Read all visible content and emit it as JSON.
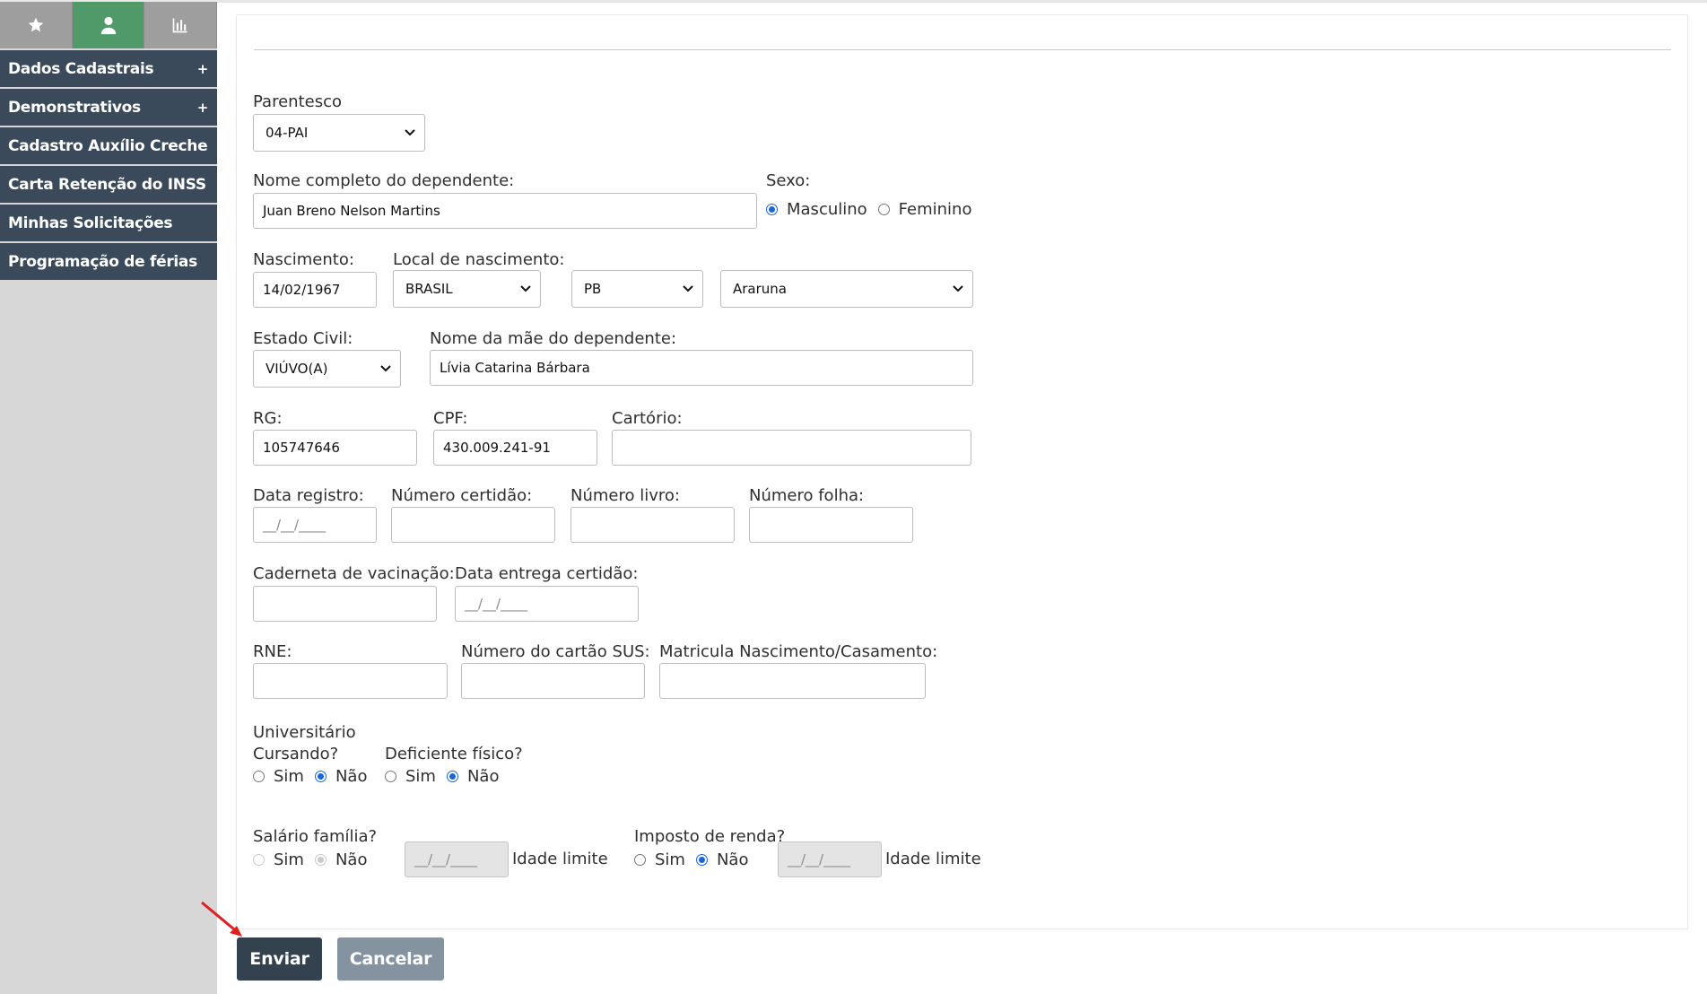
{
  "sidebar": {
    "tabs": [
      {
        "icon": "star-icon"
      },
      {
        "icon": "user-icon"
      },
      {
        "icon": "bar-chart-icon"
      }
    ],
    "items": [
      {
        "label": "Dados Cadastrais",
        "expand": "+"
      },
      {
        "label": "Demonstrativos",
        "expand": "+"
      },
      {
        "label": "Cadastro Auxílio Creche",
        "expand": ""
      },
      {
        "label": "Carta Retenção do INSS",
        "expand": ""
      },
      {
        "label": "Minhas Solicitações",
        "expand": ""
      },
      {
        "label": "Programação de férias",
        "expand": ""
      }
    ]
  },
  "form": {
    "parentesco": {
      "label": "Parentesco",
      "value": "04-PAI"
    },
    "nome": {
      "label": "Nome completo do dependente:",
      "value": "Juan Breno Nelson Martins"
    },
    "sexo": {
      "label": "Sexo:",
      "opt1": "Masculino",
      "opt2": "Feminino",
      "selected": "Masculino"
    },
    "nascimento": {
      "label": "Nascimento:",
      "value": "14/02/1967"
    },
    "local": {
      "label": "Local de nascimento:",
      "pais": "BRASIL",
      "uf": "PB",
      "cidade": "Araruna"
    },
    "estado_civil": {
      "label": "Estado Civil:",
      "value": "VIÚVO(A)"
    },
    "mae": {
      "label": "Nome da mãe do dependente:",
      "value": "Lívia Catarina Bárbara"
    },
    "rg": {
      "label": "RG:",
      "value": "105747646"
    },
    "cpf": {
      "label": "CPF:",
      "value": "430.009.241-91"
    },
    "cartorio": {
      "label": "Cartório:",
      "value": ""
    },
    "data_registro": {
      "label": "Data registro:",
      "placeholder": "__/__/____"
    },
    "numero_certidao": {
      "label": "Número certidão:",
      "value": ""
    },
    "numero_livro": {
      "label": "Número livro:",
      "value": ""
    },
    "numero_folha": {
      "label": "Número folha:",
      "value": ""
    },
    "caderneta": {
      "label": "Caderneta de vacinação:",
      "value": ""
    },
    "data_entrega": {
      "label": "Data entrega certidão:",
      "placeholder": "__/__/____"
    },
    "rne": {
      "label": "RNE:",
      "value": ""
    },
    "sus": {
      "label": "Número do cartão SUS:",
      "value": ""
    },
    "matricula": {
      "label": "Matricula Nascimento/Casamento:",
      "value": ""
    },
    "universitario": {
      "label_line1": "Universitário",
      "label_line2": "Cursando?",
      "sim": "Sim",
      "nao": "Não",
      "selected": "Não"
    },
    "deficiente": {
      "label": "Deficiente físico?",
      "sim": "Sim",
      "nao": "Não",
      "selected": "Não"
    },
    "salario_familia": {
      "label": "Salário família?",
      "sim": "Sim",
      "nao": "Não",
      "selected": "Não",
      "disabled": true,
      "date_placeholder": "__/__/____",
      "idade_label": "Idade limite"
    },
    "imposto_renda": {
      "label": "Imposto de renda?",
      "sim": "Sim",
      "nao": "Não",
      "selected": "Não",
      "date_placeholder": "__/__/____",
      "idade_label": "Idade limite"
    }
  },
  "buttons": {
    "submit": "Enviar",
    "cancel": "Cancelar"
  },
  "colors": {
    "menu_bg": "#3b4a5a",
    "active_tab": "#4f9a68",
    "primary_button": "#34414f",
    "secondary_button": "#8593a1",
    "annotation_arrow": "#e02020"
  }
}
